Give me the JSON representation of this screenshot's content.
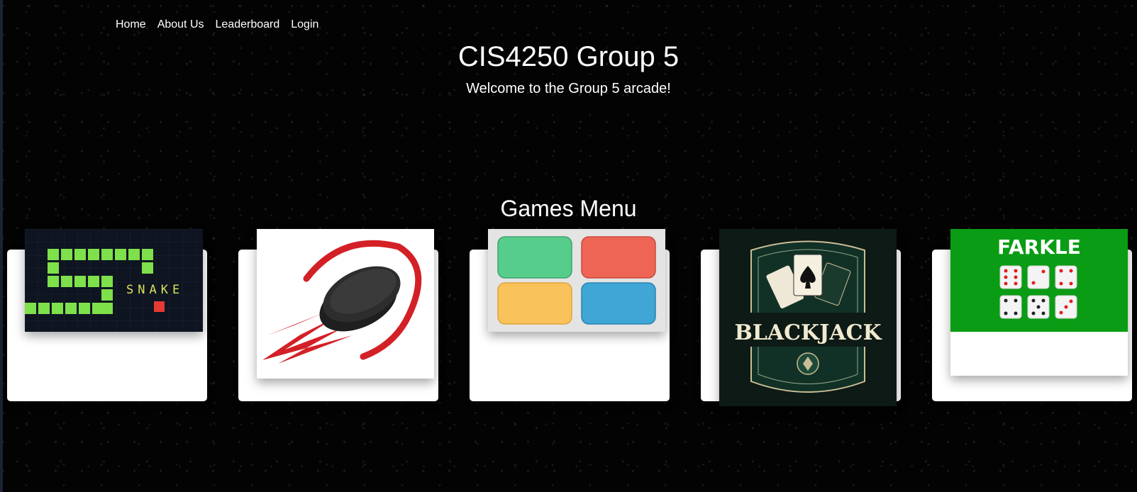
{
  "nav": {
    "items": [
      {
        "label": "Home"
      },
      {
        "label": "About Us"
      },
      {
        "label": "Leaderboard"
      },
      {
        "label": "Login"
      }
    ]
  },
  "header": {
    "title": "CIS4250 Group 5",
    "subtitle": "Welcome to the Group 5 arcade!"
  },
  "games_menu": {
    "heading": "Games Menu",
    "games": [
      {
        "icon": "snake-game-icon",
        "label": "SNAKE"
      },
      {
        "icon": "hockey-puck-icon"
      },
      {
        "icon": "color-tiles-icon"
      },
      {
        "icon": "blackjack-icon",
        "label": "BLACKJACK"
      },
      {
        "icon": "farkle-dice-icon",
        "label": "FARKLE"
      }
    ]
  },
  "colors": {
    "background": "#030303",
    "snake_green": "#7ee04a",
    "snake_bg": "#0e1420",
    "puck_red": "#d32027",
    "tile_green": "#57cd8c",
    "tile_red": "#ee6555",
    "tile_yellow": "#fac25b",
    "tile_blue": "#3fa6d6",
    "blackjack_bg": "#0d1a15",
    "farkle_green": "#0a9c14"
  }
}
